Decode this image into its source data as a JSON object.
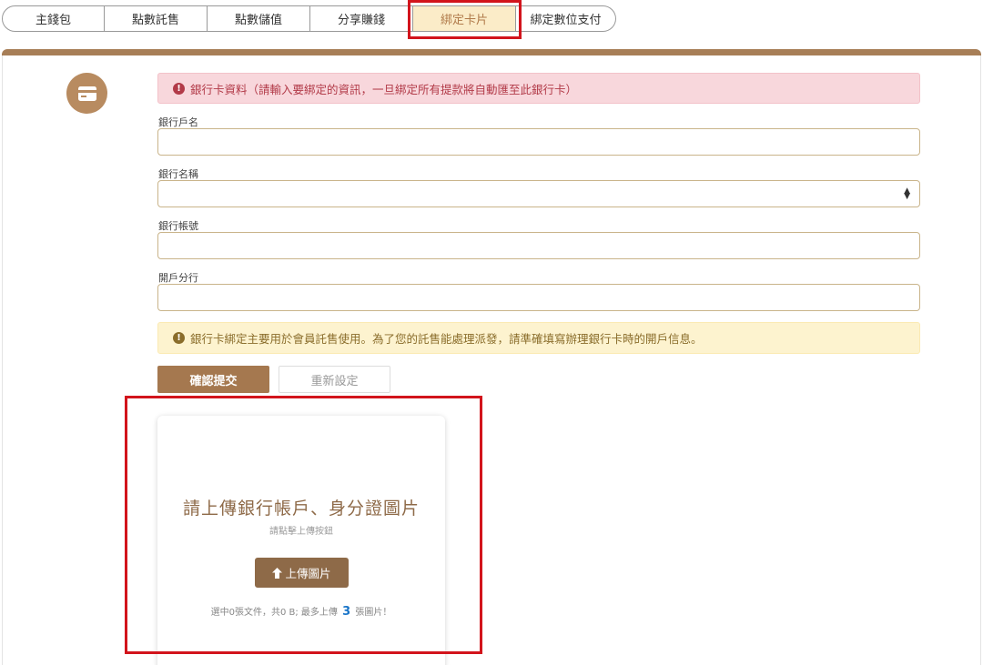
{
  "tabs": [
    {
      "label": "主錢包"
    },
    {
      "label": "點數託售"
    },
    {
      "label": "點數儲值"
    },
    {
      "label": "分享賺錢"
    },
    {
      "label": "綁定卡片"
    },
    {
      "label": "綁定數位支付"
    }
  ],
  "active_tab_index": 4,
  "colors": {
    "brand": "#a5784f",
    "highlight": "#d2141c",
    "active_tab_bg": "#fbecc8"
  },
  "form": {
    "info_alert": "銀行卡資料（請輸入要綁定的資訊，一旦綁定所有提款將自動匯至此銀行卡）",
    "account_name_label": "銀行戶名",
    "account_name_value": "",
    "bank_name_label": "銀行名稱",
    "bank_name_selected": "",
    "account_number_label": "銀行帳號",
    "account_number_value": "",
    "branch_label": "開戶分行",
    "branch_value": "",
    "warning_alert": "銀行卡綁定主要用於會員託售使用。為了您的託售能處理派發，請準確填寫辦理銀行卡時的開戶信息。",
    "submit_label": "確認提交",
    "reset_label": "重新設定"
  },
  "upload": {
    "title": "請上傳銀行帳戶、身分證圖片",
    "subtitle": "請點擊上傳按鈕",
    "button_label": "上傳圖片",
    "info_prefix": "選中0張文件，共0 B; 最多上傳",
    "max_count": "3",
    "info_suffix": "張圖片！"
  }
}
